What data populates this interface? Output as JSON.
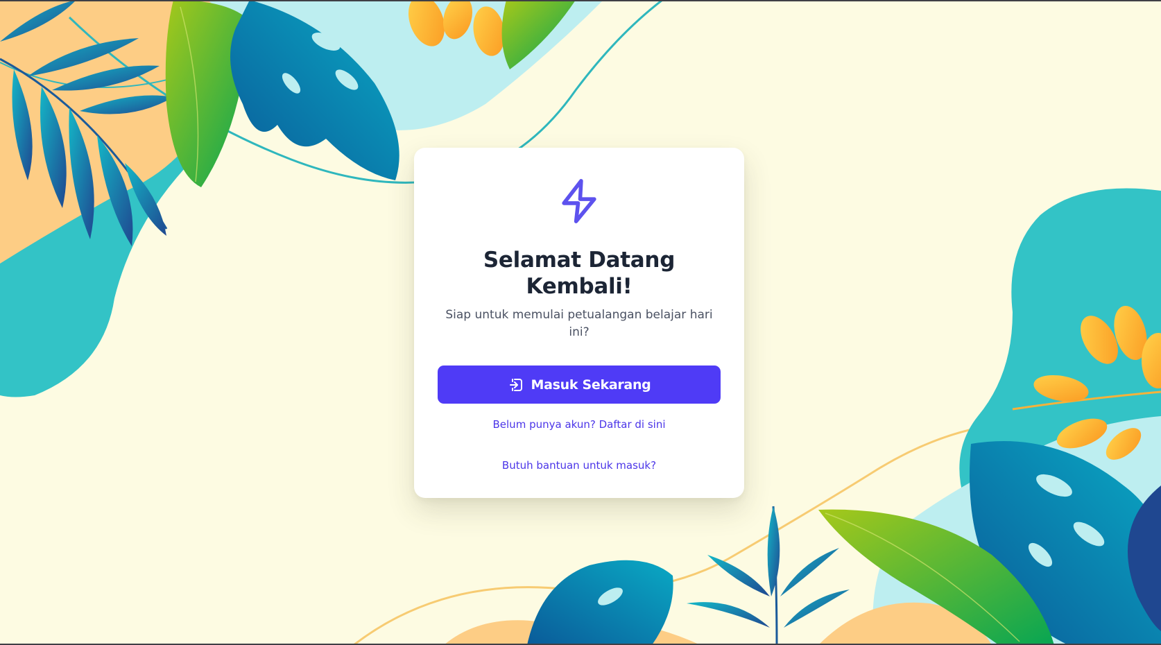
{
  "login_card": {
    "title": "Selamat Datang Kembali!",
    "subtitle": "Siap untuk memulai petualangan belajar hari ini?",
    "login_button_label": "Masuk Sekarang",
    "register_link": "Belum punya akun? Daftar di sini",
    "help_link": "Butuh bantuan untuk masuk?"
  },
  "icons": {
    "header": "lightning-bolt-icon",
    "login_button": "login-arrow-icon"
  },
  "colors": {
    "background": "#fdfbe2",
    "card": "#ffffff",
    "accent": "#4f3bf6",
    "title_text": "#1c2535",
    "body_text": "#4a5162",
    "link_text": "#4b35e8",
    "teal": "#33c3c6",
    "light_teal": "#bdeef0",
    "peach": "#fdcd85",
    "orange": "#fca82b",
    "lime": "#8dc21f",
    "green": "#09a650",
    "blue": "#0a6fa5",
    "navy": "#1f4790"
  }
}
